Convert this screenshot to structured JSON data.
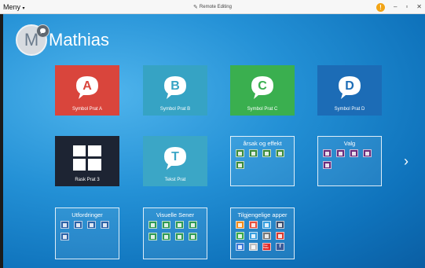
{
  "titlebar": {
    "menu_label": "Meny",
    "menu_caret": "▾",
    "center_title": "Remote Editing",
    "info_glyph": "!",
    "minimize_glyph": "–",
    "restore_glyph": "▫",
    "close_glyph": "✕"
  },
  "profile": {
    "initial": "M",
    "name": "Mathias"
  },
  "tiles": [
    {
      "label": "Symbol Prat A",
      "letter": "A",
      "color": "#d9453c"
    },
    {
      "label": "Symbol Prat B",
      "letter": "B",
      "color": "#36a3c4"
    },
    {
      "label": "Symbol Prat C",
      "letter": "C",
      "color": "#3aaf4f"
    },
    {
      "label": "Symbol Prat D",
      "letter": "D",
      "color": "#1c6cb6"
    },
    {
      "label": "Rask Prat 3",
      "letter": "",
      "color": "#1d2433"
    },
    {
      "label": "Tekst Prat",
      "letter": "T",
      "color": "#3ba6c6"
    }
  ],
  "folders": [
    {
      "title": "årsak og effekt",
      "icon_colors": [
        "#3a8a3c",
        "#3a8a3c",
        "#3a8a3c",
        "#3a8a3c",
        "#3a8a3c"
      ]
    },
    {
      "title": "Valg",
      "icon_colors": [
        "#6a2b7c",
        "#6a2b7c",
        "#6a2b7c",
        "#6a2b7c",
        "#6a2b7c"
      ]
    },
    {
      "title": "Utfordringer",
      "icon_colors": [
        "#2a62a8",
        "#2a62a8",
        "#2a62a8",
        "#2a62a8",
        "#2a62a8"
      ]
    },
    {
      "title": "Visuelle Sener",
      "icon_colors": [
        "#2f9a55",
        "#2f9a55",
        "#2f9a55",
        "#2f9a55",
        "#2f9a55",
        "#2f9a55",
        "#2f9a55",
        "#2f9a55"
      ]
    },
    {
      "title": "Tilgjengelige apper",
      "icon_colors": [
        "#f08c1c",
        "#e84f3c",
        "#37a0e0",
        "#3a4a6a",
        "#3aa848",
        "#37a0e0",
        "#777777",
        "#d83a2f",
        "#3b78d8",
        "#bfbfbf",
        "#e02a2a",
        "#3a5a99"
      ],
      "glyphs": [
        "",
        "",
        "",
        "",
        "",
        "",
        "",
        "",
        "",
        "",
        "You Tube",
        "f"
      ]
    }
  ],
  "navigation": {
    "next_glyph": "›"
  },
  "colors": {
    "background": "#1a84cc",
    "titlebar": "#f7f7f7",
    "info_badge": "#f2a416"
  }
}
